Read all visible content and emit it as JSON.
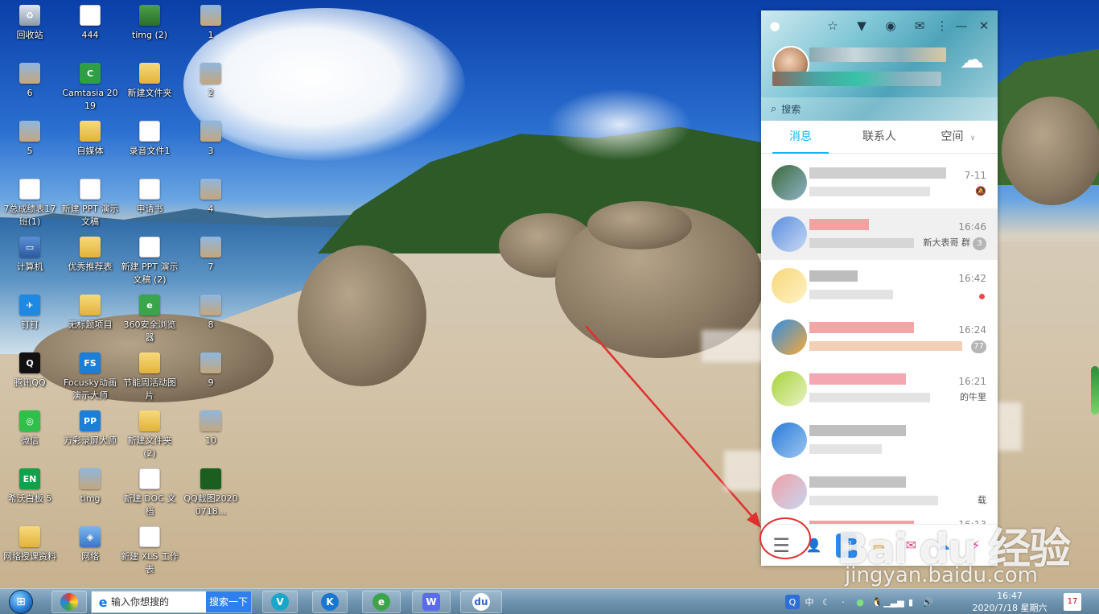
{
  "desktop": {
    "icons": [
      {
        "label": "回收站",
        "icon": "recycle-bin-icon"
      },
      {
        "label": "444",
        "icon": "file-icon"
      },
      {
        "label": "timg (2)",
        "icon": "image-icon"
      },
      {
        "label": "1",
        "icon": "image-thumb-icon"
      },
      {
        "label": "6",
        "icon": "image-thumb-icon"
      },
      {
        "label": "Camtasia 2019",
        "icon": "camtasia-icon"
      },
      {
        "label": "新建文件夹",
        "icon": "folder-icon"
      },
      {
        "label": "2",
        "icon": "image-thumb-icon"
      },
      {
        "label": "5",
        "icon": "image-thumb-icon"
      },
      {
        "label": "自媒体",
        "icon": "folder-icon"
      },
      {
        "label": "录音文件1",
        "icon": "play-icon"
      },
      {
        "label": "3",
        "icon": "image-thumb-icon"
      },
      {
        "label": "7总成绩表17班(1)",
        "icon": "xls-icon"
      },
      {
        "label": "新建 PPT 演示文稿",
        "icon": "ppt-icon"
      },
      {
        "label": "申请书",
        "icon": "doc-icon"
      },
      {
        "label": "4",
        "icon": "image-thumb-icon"
      },
      {
        "label": "计算机",
        "icon": "computer-icon"
      },
      {
        "label": "优秀推荐表",
        "icon": "folder-icon"
      },
      {
        "label": "新建 PPT 演示文稿 (2)",
        "icon": "ppt-icon"
      },
      {
        "label": "7",
        "icon": "image-thumb-icon"
      },
      {
        "label": "钉钉",
        "icon": "dingtalk-icon"
      },
      {
        "label": "无标题项目",
        "icon": "folder-icon"
      },
      {
        "label": "360安全浏览器",
        "icon": "browser-360-icon"
      },
      {
        "label": "8",
        "icon": "image-thumb-icon"
      },
      {
        "label": "腾讯QQ",
        "icon": "qq-icon"
      },
      {
        "label": "Focusky动画演示大师",
        "icon": "focusky-icon"
      },
      {
        "label": "节能周活动图片",
        "icon": "folder-icon"
      },
      {
        "label": "9",
        "icon": "image-thumb-icon"
      },
      {
        "label": "微信",
        "icon": "wechat-icon"
      },
      {
        "label": "万彩录屏大师",
        "icon": "screen-recorder-icon"
      },
      {
        "label": "新建文件夹 (2)",
        "icon": "folder-icon"
      },
      {
        "label": "10",
        "icon": "image-thumb-icon"
      },
      {
        "label": "希沃白板 5",
        "icon": "easinote-icon"
      },
      {
        "label": "timg",
        "icon": "image-thumb-icon"
      },
      {
        "label": "新建 DOC 文档",
        "icon": "doc-icon"
      },
      {
        "label": "QQ截图20200718...",
        "icon": "screenshot-icon"
      },
      {
        "label": "网络授课资料",
        "icon": "folder-icon"
      },
      {
        "label": "网络",
        "icon": "network-icon"
      },
      {
        "label": "新建 XLS 工作表",
        "icon": "xls-icon"
      }
    ]
  },
  "qq": {
    "search_placeholder": "搜索",
    "tabs": [
      "消息",
      "联系人",
      "空间"
    ],
    "tab_dropdown_glyph": "∨",
    "conversations": [
      {
        "time": "7-11",
        "status": "muted"
      },
      {
        "time": "16:46",
        "snippet": "新大表哥 群",
        "badge": "3"
      },
      {
        "time": "16:42",
        "status": "dot"
      },
      {
        "time": "16:24",
        "badge": "77"
      },
      {
        "time": "16:21",
        "snippet": "的牛里"
      },
      {
        "time": ""
      },
      {
        "time": "",
        "snippet": "载"
      },
      {
        "time": "16:13"
      }
    ]
  },
  "watermark": {
    "logo": "Bai du 经验",
    "url": "jingyan.baidu.com"
  },
  "taskbar": {
    "search_placeholder": "输入你想搜的",
    "search_button": "搜索一下",
    "tray_ime": "中",
    "clock_time": "16:47",
    "clock_date": "2020/7/18 星期六",
    "notify_count": "17"
  },
  "colors": {
    "qq_accent": "#12b7f5",
    "annotation_red": "#e03030",
    "taskbar": "#6f94b0"
  }
}
